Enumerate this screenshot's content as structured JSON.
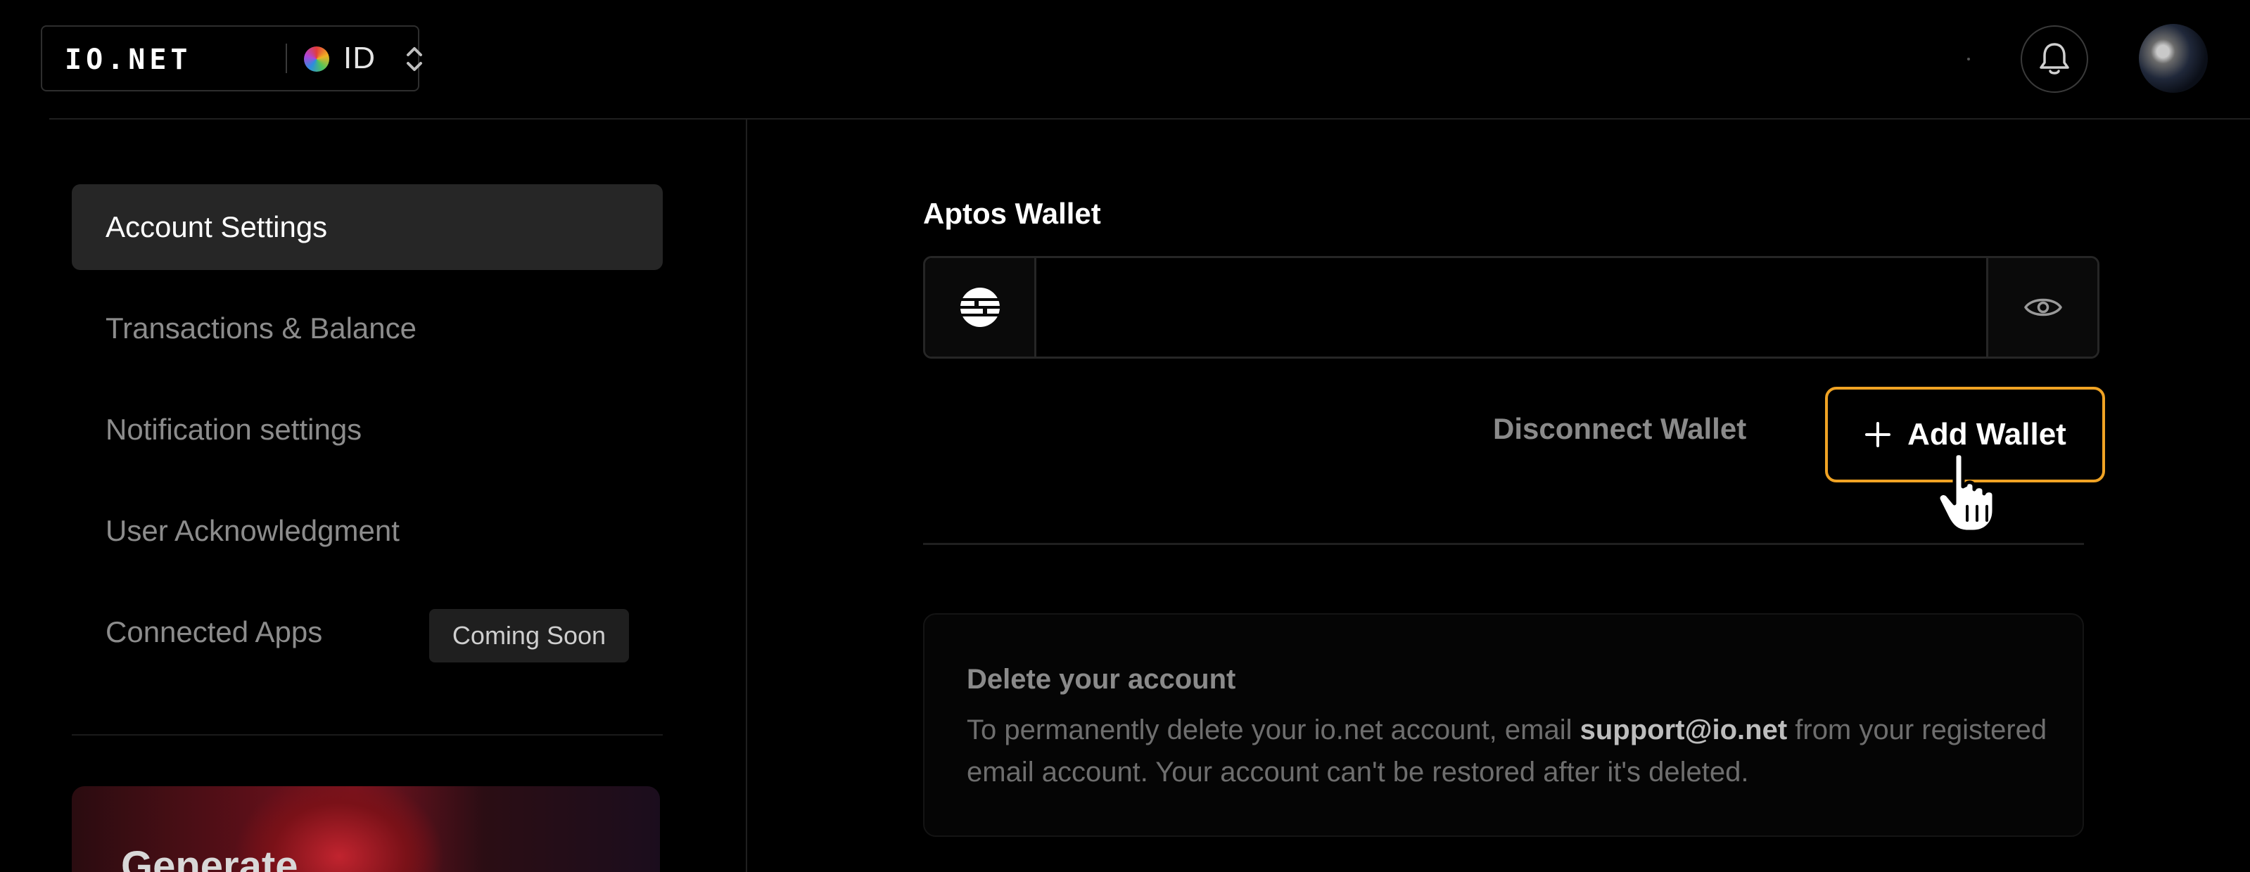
{
  "header": {
    "logo_text": "IO.NET",
    "switcher_label": "ID"
  },
  "sidebar": {
    "items": [
      {
        "label": "Account Settings",
        "active": true
      },
      {
        "label": "Transactions & Balance",
        "active": false
      },
      {
        "label": "Notification settings",
        "active": false
      },
      {
        "label": "User Acknowledgment",
        "active": false
      },
      {
        "label": "Connected Apps",
        "active": false
      }
    ],
    "coming_soon_badge": "Coming Soon",
    "promo_title": "Generate"
  },
  "wallet": {
    "label": "Aptos Wallet",
    "value": "",
    "disconnect_label": "Disconnect Wallet",
    "add_label": "Add Wallet"
  },
  "delete_account": {
    "title": "Delete your account",
    "text_before": "To permanently delete your io.net account, email ",
    "email": "support@io.net",
    "text_after": " from your registered email account. Your account can't be restored after it's deleted."
  },
  "colors": {
    "accent": "#f0a324",
    "background": "#000000",
    "active_nav": "#262626"
  },
  "icons": [
    "io-net-logo",
    "color-dot-icon",
    "chevron-updown-icon",
    "bell-icon",
    "avatar",
    "aptos-icon",
    "eye-icon",
    "plus-icon",
    "hand-cursor-icon"
  ]
}
